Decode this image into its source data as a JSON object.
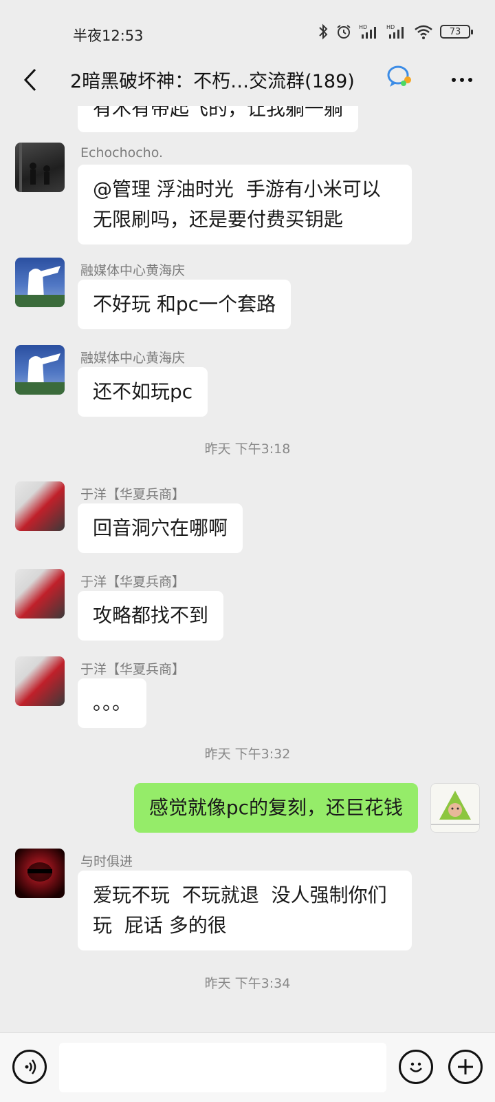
{
  "status": {
    "time": "半夜12:53",
    "battery": "73"
  },
  "header": {
    "title": "2暗黑破坏神：不朽…交流群(189)"
  },
  "messages": {
    "partial_text": "有木有带起飞的，让我躺一躺",
    "m1": {
      "sender": "Echochocho.",
      "text": "@管理 浮油时光  手游有小米可以\n无限刷吗，还是要付费买钥匙"
    },
    "m2": {
      "sender": "融媒体中心黄海庆",
      "text": "不好玩 和pc一个套路"
    },
    "m3": {
      "sender": "融媒体中心黄海庆",
      "text": "还不如玩pc"
    },
    "t1": "昨天 下午3:18",
    "m4": {
      "sender": "于洋【华夏兵商】",
      "text": "回音洞穴在哪啊"
    },
    "m5": {
      "sender": "于洋【华夏兵商】",
      "text": "攻略都找不到"
    },
    "m6": {
      "sender": "于洋【华夏兵商】",
      "text": "。。。"
    },
    "t2": "昨天 下午3:32",
    "m7": {
      "text": "感觉就像pc的复刻，还巨花钱"
    },
    "m8": {
      "sender": "与时俱进",
      "text": "爱玩不玩  不玩就退  没人强制你们\n玩  屁话 多的很"
    },
    "t3": "昨天 下午3:34"
  },
  "colors": {
    "self_bubble": "#95ec69",
    "bubble": "#ffffff",
    "background": "#ededed"
  },
  "icons": [
    "back-icon",
    "group-chat-icon",
    "more-icon",
    "voice-icon",
    "emoji-icon",
    "plus-icon"
  ]
}
